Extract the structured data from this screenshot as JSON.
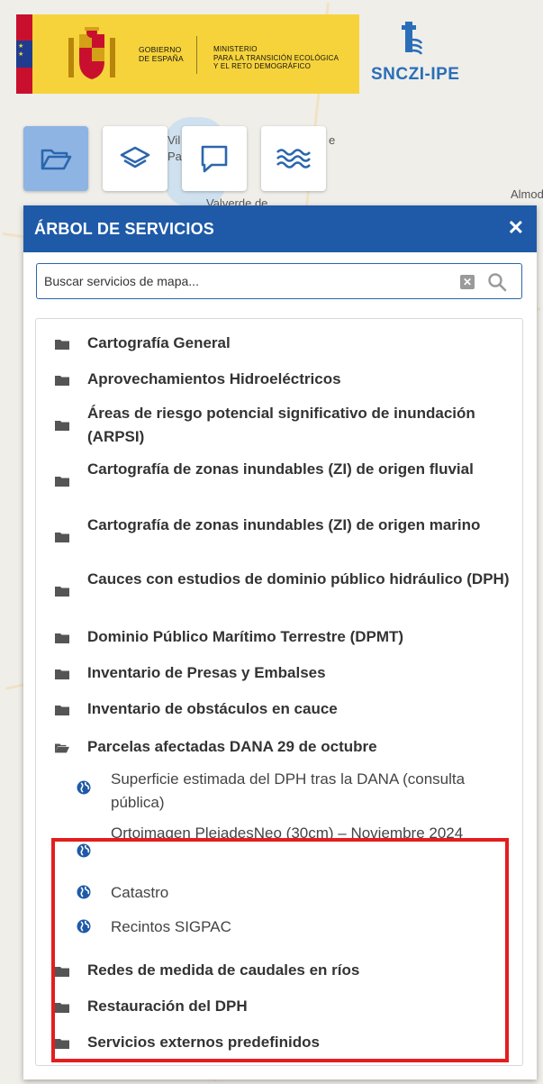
{
  "header": {
    "gov_line1": "GOBIERNO",
    "gov_line2": "DE ESPAÑA",
    "ministry_line1": "MINISTERIO",
    "ministry_line2": "PARA LA TRANSICIÓN ECOLÓGICA",
    "ministry_line3": "Y EL RETO DEMOGRÁFICO",
    "brand": "SNCZI-IPE"
  },
  "map_labels": {
    "valverde": "Valverde de",
    "almod": "Almod",
    "vil": "Vil",
    "pa": "Pa",
    "e": "e"
  },
  "toolbar": {
    "icons": [
      "folder-icon",
      "layers-icon",
      "comment-icon",
      "water-icon"
    ]
  },
  "panel": {
    "title": "ÁRBOL DE SERVICIOS",
    "close": "✕",
    "search_placeholder": "Buscar servicios de mapa...",
    "clear": "✕",
    "items": [
      {
        "label": "Cartografía General"
      },
      {
        "label": "Aprovechamientos Hidroeléctricos"
      },
      {
        "label": "Áreas de riesgo potencial significativo de inundación (ARPSI)"
      },
      {
        "label": "Cartografía de zonas inundables (ZI) de origen fluvial"
      },
      {
        "label": "Cartografía de zonas inundables (ZI) de origen marino"
      },
      {
        "label": "Cauces con estudios de dominio público hidráulico (DPH)"
      },
      {
        "label": "Dominio Público Marítimo Terrestre (DPMT)"
      },
      {
        "label": "Inventario de Presas y Embalses"
      },
      {
        "label": "Inventario de obstáculos en cauce"
      },
      {
        "label": "Parcelas afectadas DANA 29 de octubre"
      },
      {
        "label": "Redes de medida de caudales en ríos"
      },
      {
        "label": "Restauración del DPH"
      },
      {
        "label": "Servicios externos predefinidos"
      }
    ],
    "dana_children": [
      {
        "label": "Superficie estimada del DPH tras la DANA (consulta pública)"
      },
      {
        "label": "Ortoimagen PleiadesNeo (30cm) – Noviembre 2024"
      },
      {
        "label": "Catastro"
      },
      {
        "label": "Recintos SIGPAC"
      }
    ]
  },
  "colors": {
    "panel_header": "#1e5aa8",
    "highlight": "#e41d1d",
    "toolbar_active": "#8db4e3",
    "banner": "#f6d33b"
  }
}
